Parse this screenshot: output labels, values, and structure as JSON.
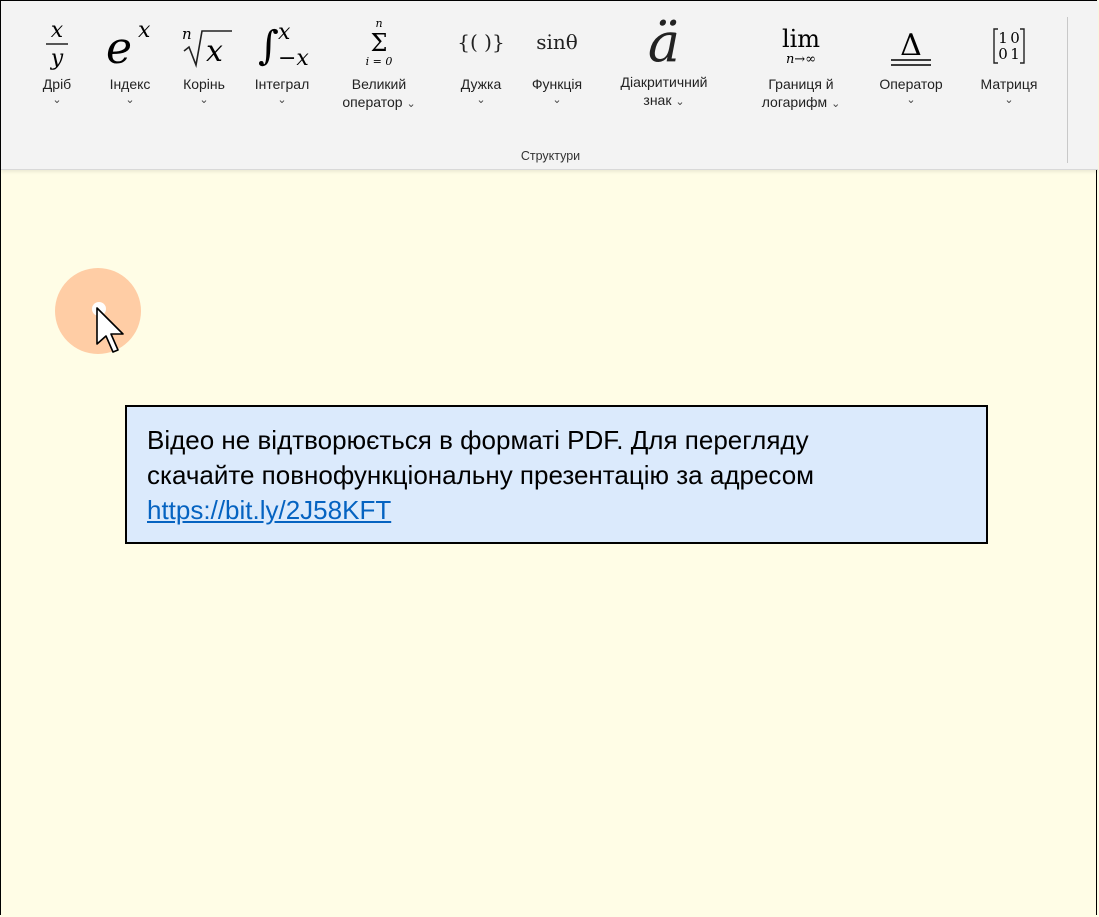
{
  "ribbon": {
    "group_label": "Структури",
    "tools": [
      {
        "id": "fraction",
        "label": "Дріб",
        "icon": "fraction-icon",
        "symbol": "x/y"
      },
      {
        "id": "index",
        "label": "Індекс",
        "icon": "superscript-icon",
        "symbol": "e^x"
      },
      {
        "id": "root",
        "label": "Корінь",
        "icon": "radical-icon",
        "symbol": "n√x"
      },
      {
        "id": "integral",
        "label": "Інтеграл",
        "icon": "integral-icon",
        "symbol": "∫"
      },
      {
        "id": "large-operator",
        "label": "Великий",
        "label2": "оператор",
        "icon": "summation-icon",
        "symbol": "Σ"
      },
      {
        "id": "bracket",
        "label": "Дужка",
        "icon": "bracket-icon",
        "symbol": "{()}"
      },
      {
        "id": "function",
        "label": "Функція",
        "icon": "function-icon",
        "symbol": "sinθ"
      },
      {
        "id": "accent",
        "label": "Діакритичний",
        "label2": "знак",
        "icon": "accent-icon",
        "symbol": "ä"
      },
      {
        "id": "limit",
        "label": "Границя й",
        "label2": "логарифм",
        "icon": "limit-icon",
        "symbol": "lim"
      },
      {
        "id": "operator",
        "label": "Оператор",
        "icon": "operator-icon",
        "symbol": "Δ"
      },
      {
        "id": "matrix",
        "label": "Матриця",
        "icon": "matrix-icon",
        "symbol": "[10;01]"
      }
    ]
  },
  "glyphs": {
    "x": "x",
    "y": "y",
    "e": "e",
    "n": "n",
    "i0": "i = 0",
    "neg_x": "−x",
    "brackets": "{( )}",
    "sin": "sinθ",
    "a_umlaut": "ä",
    "lim": "lim",
    "n_inf": "n→∞",
    "delta": "Δ",
    "m11": "1",
    "m12": "0",
    "m21": "0",
    "m22": "1",
    "chevron": "⌄"
  },
  "notice": {
    "line1": "Відео не відтворюється в форматі PDF. Для перегляду",
    "line2": "скачайте повнофункціональну презентацію за адресом",
    "link": "https://bit.ly/2J58KFT"
  },
  "colors": {
    "slide_background": "#fffde6",
    "notice_background": "#dbeafc",
    "link": "#0563c1",
    "cursor_highlight": "#ffc9a0"
  }
}
